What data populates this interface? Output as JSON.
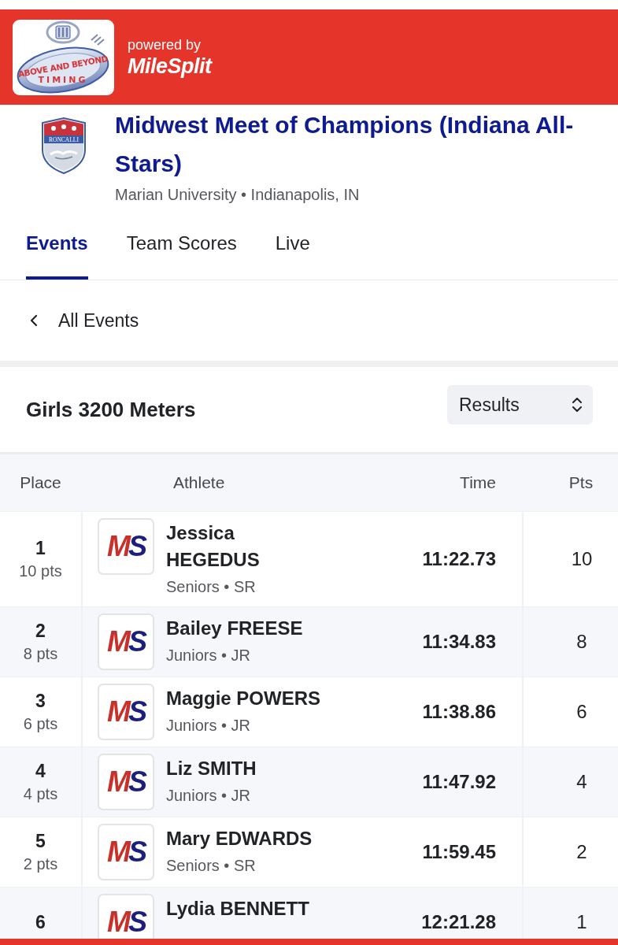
{
  "banner": {
    "logo_lines": [
      "ABOVE AND BEYOND",
      "TIMING"
    ],
    "powered_by": "powered by",
    "brand": "MileSplit"
  },
  "meet": {
    "logo_text": "RONCALLI",
    "title": "Midwest Meet of Champions (Indiana All-Stars)",
    "subtitle": "Marian University • Indianapolis, IN"
  },
  "tabs": [
    {
      "label": "Events",
      "selected": true
    },
    {
      "label": "Team Scores",
      "selected": false
    },
    {
      "label": "Live",
      "selected": false
    }
  ],
  "back_link": {
    "label": "All Events"
  },
  "event": {
    "title": "Girls 3200 Meters",
    "view_select": {
      "value": "Results"
    }
  },
  "table": {
    "columns": [
      "Place",
      "Athlete",
      "Time",
      "Pts"
    ],
    "rows": [
      {
        "place": "1",
        "place_points": "10 pts",
        "logo_text": "MS",
        "name": "Jessica HEGEDUS",
        "team": "Seniors • SR",
        "time": "11:22.73",
        "points": "10"
      },
      {
        "place": "2",
        "place_points": "8 pts",
        "logo_text": "MS",
        "name": "Bailey FREESE",
        "team": "Juniors • JR",
        "time": "11:34.83",
        "points": "8"
      },
      {
        "place": "3",
        "place_points": "6 pts",
        "logo_text": "MS",
        "name": "Maggie POWERS",
        "team": "Juniors • JR",
        "time": "11:38.86",
        "points": "6"
      },
      {
        "place": "4",
        "place_points": "4 pts",
        "logo_text": "MS",
        "name": "Liz SMITH",
        "team": "Juniors • JR",
        "time": "11:47.92",
        "points": "4"
      },
      {
        "place": "5",
        "place_points": "2 pts",
        "logo_text": "MS",
        "name": "Mary EDWARDS",
        "team": "Seniors • SR",
        "time": "11:59.45",
        "points": "2"
      },
      {
        "place": "6",
        "logo_text": "MS",
        "name": "Lydia BENNETT",
        "time": "12:21.28",
        "points": "1"
      }
    ]
  }
}
